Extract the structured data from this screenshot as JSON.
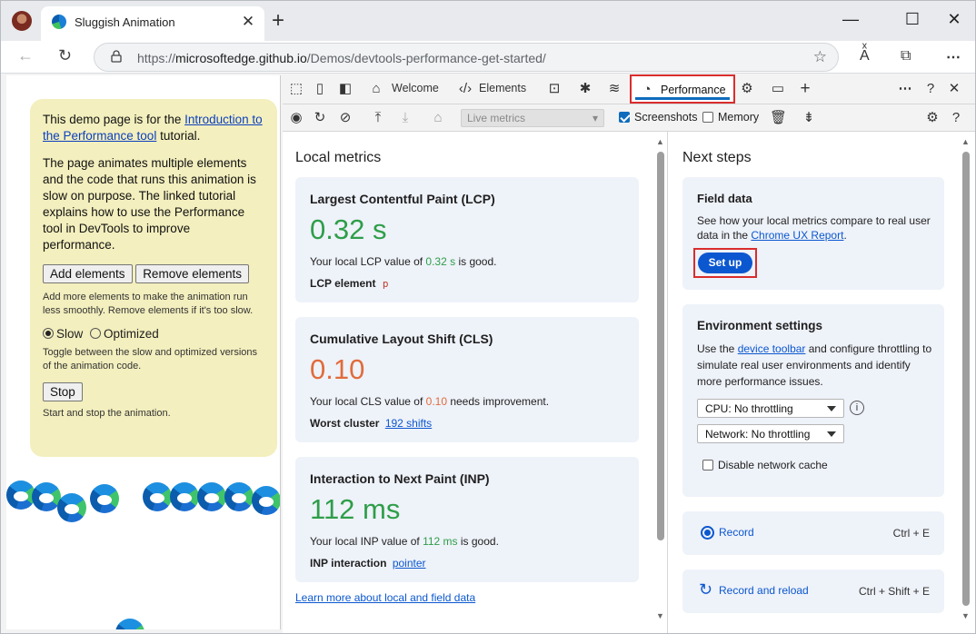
{
  "browser": {
    "tab_title": "Sluggish Animation",
    "url_scheme": "https://",
    "url_host": "microsoftedge.github.io",
    "url_path": "/Demos/devtools-performance-get-started/"
  },
  "page": {
    "intro_prefix": "This demo page is for the ",
    "intro_link": "Introduction to the Performance tool",
    "intro_suffix": " tutorial.",
    "description": "The page animates multiple elements and the code that runs this animation is slow on purpose. The linked tutorial explains how to use the Performance tool in DevTools to improve performance.",
    "add_button": "Add elements",
    "remove_button": "Remove elements",
    "add_remove_help": "Add more elements to make the animation run less smoothly. Remove elements if it's too slow.",
    "radio_slow": "Slow",
    "radio_optimized": "Optimized",
    "toggle_help": "Toggle between the slow and optimized versions of the animation code.",
    "stop_button": "Stop",
    "stop_help": "Start and stop the animation."
  },
  "devtools": {
    "tabs": {
      "welcome": "Welcome",
      "elements": "Elements",
      "performance": "Performance"
    },
    "toolbar": {
      "live_metrics": "Live metrics",
      "screenshots": "Screenshots",
      "memory": "Memory"
    },
    "local_metrics": {
      "heading": "Local metrics",
      "lcp": {
        "title": "Largest Contentful Paint (LCP)",
        "value": "0.32 s",
        "note_prefix": "Your local LCP value of ",
        "note_value": "0.32 s",
        "note_suffix": " is good.",
        "detail_label": "LCP element",
        "detail_value": "p"
      },
      "cls": {
        "title": "Cumulative Layout Shift (CLS)",
        "value": "0.10",
        "note_prefix": "Your local CLS value of ",
        "note_value": "0.10",
        "note_suffix": " needs improvement.",
        "detail_label": "Worst cluster",
        "detail_value": "192 shifts"
      },
      "inp": {
        "title": "Interaction to Next Paint (INP)",
        "value": "112 ms",
        "note_prefix": "Your local INP value of ",
        "note_value": "112 ms",
        "note_suffix": " is good.",
        "detail_label": "INP interaction",
        "detail_value": "pointer"
      },
      "learn_more": "Learn more about local and field data"
    },
    "next_steps": {
      "heading": "Next steps",
      "field_data": {
        "title": "Field data",
        "text_prefix": "See how your local metrics compare to real user data in the ",
        "link": "Chrome UX Report",
        "text_suffix": ".",
        "button": "Set up"
      },
      "environment": {
        "title": "Environment settings",
        "text_prefix": "Use the ",
        "link": "device toolbar",
        "text_suffix": " and configure throttling to simulate real user environments and identify more performance issues.",
        "cpu": "CPU: No throttling",
        "network": "Network: No throttling",
        "disable_cache": "Disable network cache"
      },
      "record": {
        "label": "Record",
        "shortcut": "Ctrl + E"
      },
      "record_reload": {
        "label": "Record and reload",
        "shortcut": "Ctrl + Shift + E"
      }
    }
  },
  "colors": {
    "good": "#2e9e49",
    "needs_improvement": "#e06c3c",
    "accent": "#0b57d0",
    "highlight": "#d92d2d"
  }
}
